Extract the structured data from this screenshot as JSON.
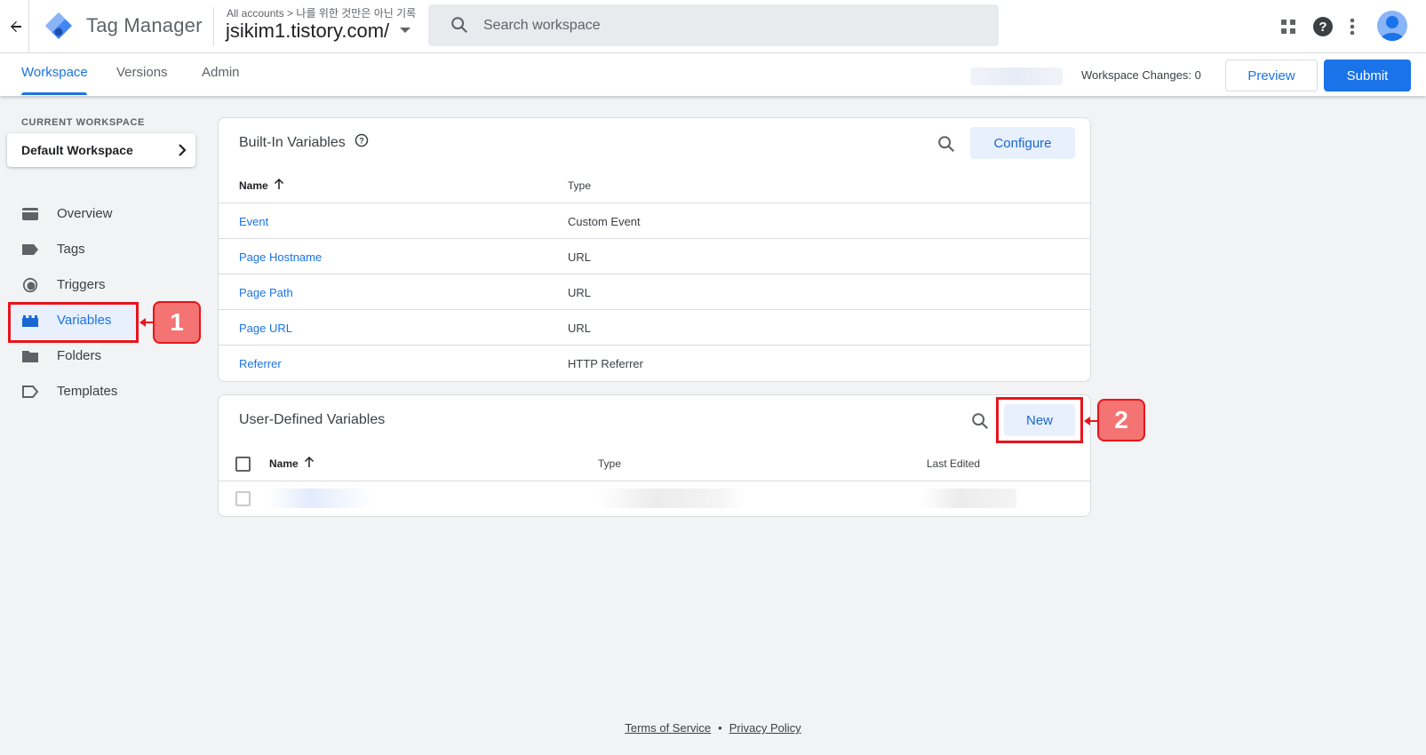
{
  "header": {
    "back_icon": "arrow-back-icon",
    "app_name": "Tag Manager",
    "breadcrumb": {
      "all_accounts": "All accounts",
      "separator": ">",
      "account": "나를 위한 것만은 아닌 기록"
    },
    "container_name": "jsikim1.tistory.com/",
    "search_placeholder": "Search workspace"
  },
  "tabs": [
    {
      "label": "Workspace",
      "active": true
    },
    {
      "label": "Versions",
      "active": false
    },
    {
      "label": "Admin",
      "active": false
    }
  ],
  "toolbar": {
    "workspace_changes": "Workspace Changes: 0",
    "preview_label": "Preview",
    "submit_label": "Submit"
  },
  "sidebar": {
    "current_workspace_label": "CURRENT WORKSPACE",
    "workspace_name": "Default Workspace",
    "items": [
      {
        "label": "Overview",
        "icon": "overview-icon",
        "active": false
      },
      {
        "label": "Tags",
        "icon": "tag-icon",
        "active": false
      },
      {
        "label": "Triggers",
        "icon": "trigger-icon",
        "active": false
      },
      {
        "label": "Variables",
        "icon": "variables-icon",
        "active": true
      },
      {
        "label": "Folders",
        "icon": "folder-icon",
        "active": false
      },
      {
        "label": "Templates",
        "icon": "template-icon",
        "active": false
      }
    ]
  },
  "builtin": {
    "title": "Built-In Variables",
    "configure_label": "Configure",
    "columns": {
      "name": "Name",
      "type": "Type"
    },
    "rows": [
      {
        "name": "Event",
        "type": "Custom Event"
      },
      {
        "name": "Page Hostname",
        "type": "URL"
      },
      {
        "name": "Page Path",
        "type": "URL"
      },
      {
        "name": "Page URL",
        "type": "URL"
      },
      {
        "name": "Referrer",
        "type": "HTTP Referrer"
      }
    ]
  },
  "userdefined": {
    "title": "User-Defined Variables",
    "new_label": "New",
    "columns": {
      "name": "Name",
      "type": "Type",
      "last_edited": "Last Edited"
    }
  },
  "annotations": {
    "badge1": "1",
    "badge2": "2",
    "color": "#e8141c"
  },
  "footer": {
    "terms": "Terms of Service",
    "separator": "•",
    "privacy": "Privacy Policy"
  },
  "colors": {
    "accent": "#1a73e8",
    "background": "#f1f3f4"
  }
}
